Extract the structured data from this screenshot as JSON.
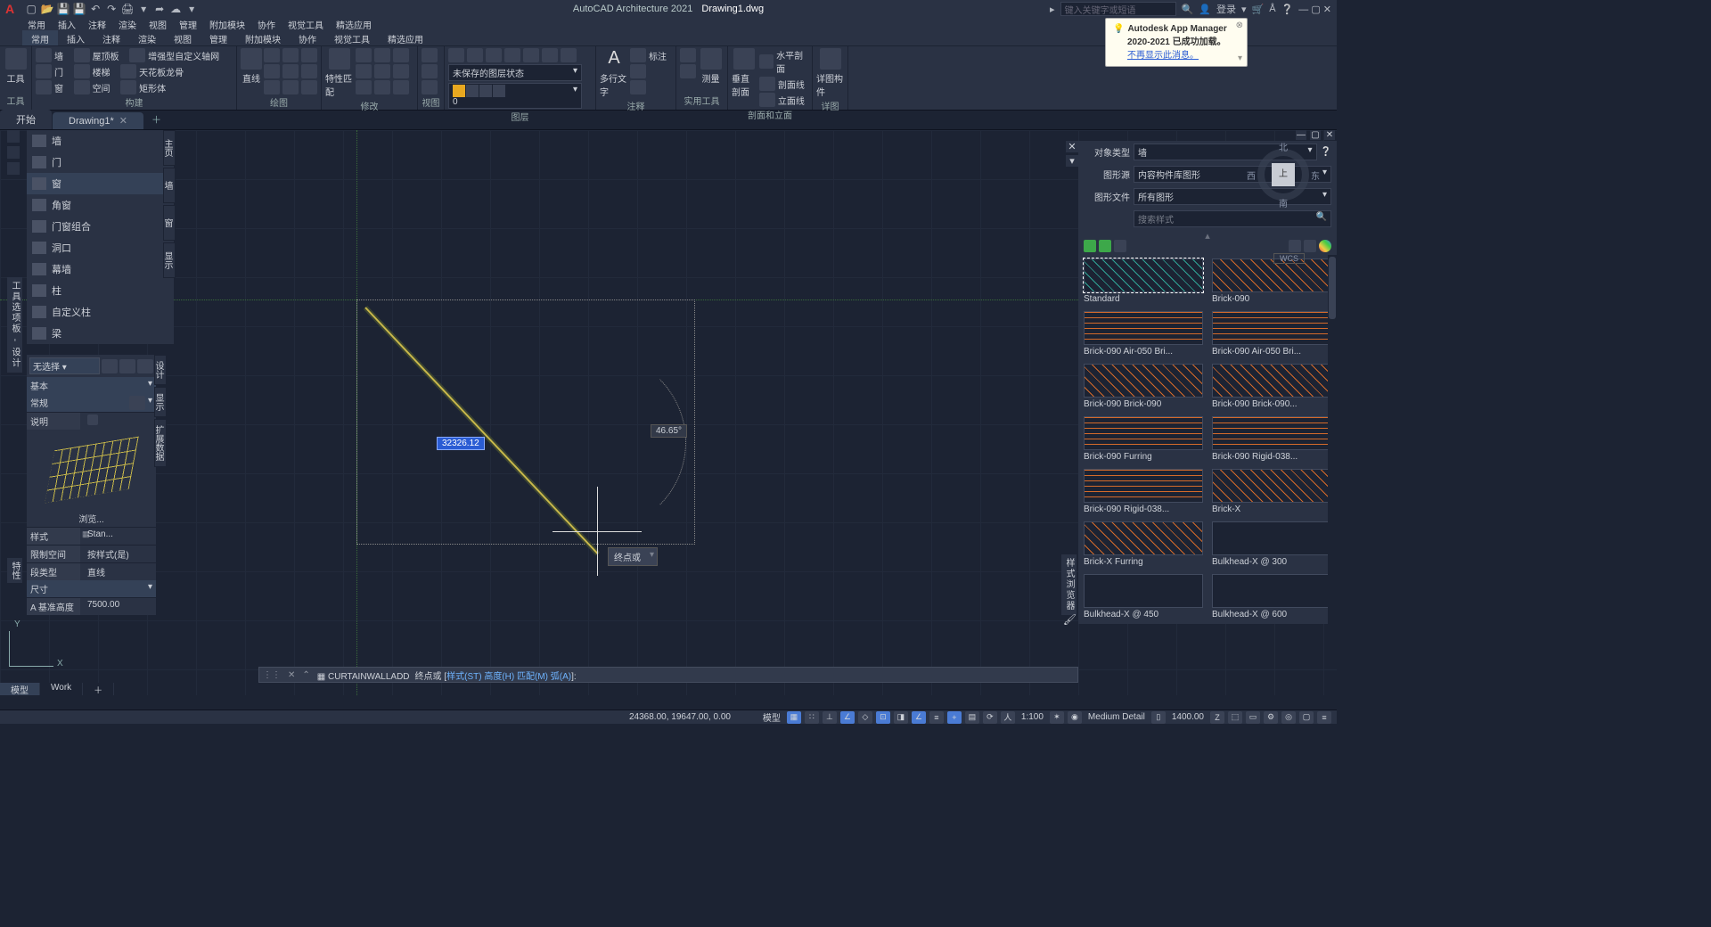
{
  "app": {
    "title": "AutoCAD Architecture 2021",
    "drawing": "Drawing1.dwg",
    "search_placeholder": "键入关键字或短语",
    "login": "登录"
  },
  "menu": [
    "常用",
    "插入",
    "注释",
    "渲染",
    "视图",
    "管理",
    "附加模块",
    "协作",
    "视觉工具",
    "精选应用"
  ],
  "ribbon_tabs": [
    "常用",
    "插入",
    "注释",
    "渲染",
    "视图",
    "管理",
    "附加模块",
    "协作",
    "视觉工具",
    "精选应用"
  ],
  "ribbon": {
    "tools": {
      "title": "工具",
      "btn": "工具"
    },
    "build": {
      "title": "构建",
      "rows": [
        [
          "墙",
          "屋顶板",
          "增强型自定义轴网"
        ],
        [
          "门",
          "楼梯",
          "天花板龙骨"
        ],
        [
          "窗",
          "空间",
          "矩形体"
        ]
      ]
    },
    "draw": {
      "title": "绘图",
      "btn": "直线"
    },
    "modify": {
      "title": "修改",
      "btn": "特性匹配"
    },
    "view": {
      "title": "视图"
    },
    "layers": {
      "title": "图层",
      "state": "未保存的图层状态",
      "current": "0"
    },
    "annotate": {
      "title": "注释",
      "txt": "多行文字",
      "dim": "标注"
    },
    "inquiry": {
      "title": "实用工具",
      "btn": "测量"
    },
    "section": {
      "title": "剖面和立面",
      "btn1": "垂直剖面",
      "r1": "水平剖面",
      "r2": "剖面线",
      "r3": "立面线"
    },
    "details": {
      "title": "详图",
      "btn": "详图构件"
    }
  },
  "doctabs": {
    "start": "开始",
    "active": "Drawing1*"
  },
  "left_palette": {
    "header": "",
    "items": [
      "墙",
      "门",
      "窗",
      "角窗",
      "门窗组合",
      "洞口",
      "幕墙",
      "柱",
      "自定义柱",
      "梁"
    ],
    "selected_index": 2,
    "tabs": [
      "主页",
      "墙",
      "窗",
      "显示"
    ]
  },
  "left_vert_label": "工具选项板 - 设计",
  "props": {
    "no_sel": "无选择",
    "cat": "基本",
    "sub": "常规",
    "desc": "说明",
    "browse": "浏览...",
    "rows": {
      "style_k": "样式",
      "style_v": "Stan...",
      "limit_k": "限制空间",
      "limit_v": "按样式(是)",
      "seg_k": "段类型",
      "seg_v": "直线",
      "dim_k": "尺寸",
      "height_k": "A 基准高度",
      "height_v": "7500.00"
    },
    "tabs": [
      "设计",
      "显示",
      "扩展数据"
    ]
  },
  "props_vert_label": "特性",
  "canvas": {
    "dist": "32326.12",
    "angle": "46.65°",
    "endpoint": "终点或"
  },
  "cmd": {
    "name": "CURTAINWALLADD",
    "text": "终点或 [",
    "opts": "样式(ST) 高度(H) 匹配(M) 弧(A)",
    "tail": "]:"
  },
  "styles_panel": {
    "obj_type_k": "对象类型",
    "obj_type_v": "墙",
    "src_k": "图形源",
    "src_v": "内容构件库图形",
    "file_k": "图形文件",
    "file_v": "所有图形",
    "search": "搜索样式",
    "items": [
      {
        "name": "Standard",
        "kind": "diag teal"
      },
      {
        "name": "Brick-090",
        "kind": "diag"
      },
      {
        "name": "Brick-090 Air-050 Bri...",
        "kind": "hlines"
      },
      {
        "name": "Brick-090 Air-050 Bri...",
        "kind": "hlines"
      },
      {
        "name": "Brick-090 Brick-090",
        "kind": "diag"
      },
      {
        "name": "Brick-090 Brick-090...",
        "kind": "diag"
      },
      {
        "name": "Brick-090 Furring",
        "kind": "hlines"
      },
      {
        "name": "Brick-090 Rigid-038...",
        "kind": "hlines"
      },
      {
        "name": "Brick-090 Rigid-038...",
        "kind": "hlines"
      },
      {
        "name": "Brick-X",
        "kind": "diag"
      },
      {
        "name": "Brick-X Furring",
        "kind": "diag"
      },
      {
        "name": "Bulkhead-X @ 300",
        "kind": ""
      },
      {
        "name": "Bulkhead-X @ 450",
        "kind": ""
      },
      {
        "name": "Bulkhead-X @ 600",
        "kind": ""
      }
    ]
  },
  "styles_vert_label": "样式浏览器",
  "notif": {
    "title1": "Autodesk App Manager",
    "title2": "2020-2021 已成功加载。",
    "link": "不再显示此消息。"
  },
  "viewcube": {
    "top": "上",
    "n": "北",
    "s": "南",
    "e": "东",
    "w": "西",
    "wcs": "WCS"
  },
  "ucs": {
    "x": "X",
    "y": "Y"
  },
  "status": {
    "coords": "24368.00, 19647.00, 0.00",
    "model": "模型",
    "scale": "1:100",
    "detail": "Medium Detail",
    "cut": "1400.00"
  },
  "btabs": [
    "模型",
    "Work"
  ]
}
